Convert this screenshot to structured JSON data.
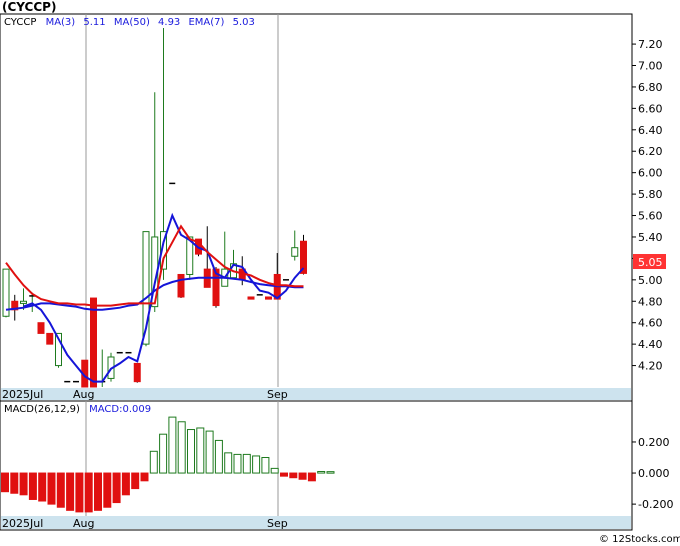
{
  "ticker": "(CYCCP)",
  "legend": {
    "symbol": "CYCCP",
    "ma3_label": "MA(3)",
    "ma3_value": "5.11",
    "ma50_label": "MA(50)",
    "ma50_value": "4.93",
    "ema7_label": "EMA(7)",
    "ema7_value": "5.03"
  },
  "last_price_label": "5.05",
  "macd_legend": {
    "params": "MACD(26,12,9)",
    "value": "MACD:0.009"
  },
  "month_labels_price": [
    "2025Jul",
    "Aug",
    "Sep"
  ],
  "month_labels_macd": [
    "2025Jul",
    "Aug",
    "Sep"
  ],
  "watermark": "© 12Stocks.com",
  "colors": {
    "up_candle": "#1e7a1e",
    "down_candle": "#e01010",
    "ma3": "#1515d8",
    "ma50": "#1515d8",
    "ema7": "#e01010",
    "axis_band": "#cde3ee",
    "last_price_box": "#ff3333",
    "macd_positive": "#1e7a1e",
    "macd_negative": "#e01010"
  },
  "chart_data": [
    {
      "type": "candlestick",
      "title": "(CYCCP)",
      "ylim": [
        4.0,
        7.35
      ],
      "yticks": [
        4.2,
        4.4,
        4.6,
        4.8,
        5.0,
        5.2,
        5.4,
        5.6,
        5.8,
        6.0,
        6.2,
        6.4,
        6.6,
        6.8,
        7.0,
        7.2
      ],
      "ytick_labels": [
        "4.20",
        "4.40",
        "4.60",
        "4.80",
        "5.00",
        "5.20",
        "5.40",
        "5.60",
        "5.80",
        "6.00",
        "6.20",
        "6.40",
        "6.60",
        "6.80",
        "7.00",
        "7.20"
      ],
      "candles": [
        {
          "o": 4.66,
          "h": 5.1,
          "l": 4.65,
          "c": 5.1
        },
        {
          "o": 4.8,
          "h": 4.86,
          "l": 4.62,
          "c": 4.72
        },
        {
          "o": 4.78,
          "h": 4.92,
          "l": 4.72,
          "c": 4.8
        },
        {
          "o": 4.85,
          "h": 4.88,
          "l": 4.7,
          "c": 4.85
        },
        {
          "o": 4.6,
          "h": 4.6,
          "l": 4.5,
          "c": 4.5
        },
        {
          "o": 4.5,
          "h": 4.5,
          "l": 4.4,
          "c": 4.4
        },
        {
          "o": 4.2,
          "h": 4.5,
          "l": 4.18,
          "c": 4.5
        },
        {
          "o": 4.05,
          "h": 4.05,
          "l": 4.05,
          "c": 4.05
        },
        {
          "o": 4.05,
          "h": 4.05,
          "l": 4.05,
          "c": 4.05
        },
        {
          "o": 4.25,
          "h": 4.25,
          "l": 4.0,
          "c": 4.0
        },
        {
          "o": 4.83,
          "h": 4.83,
          "l": 4.0,
          "c": 4.0
        },
        {
          "o": 4.04,
          "h": 4.35,
          "l": 4.0,
          "c": 4.05
        },
        {
          "o": 4.08,
          "h": 4.32,
          "l": 4.05,
          "c": 4.28
        },
        {
          "o": 4.32,
          "h": 4.32,
          "l": 4.32,
          "c": 4.32
        },
        {
          "o": 4.32,
          "h": 4.32,
          "l": 4.32,
          "c": 4.32
        },
        {
          "o": 4.22,
          "h": 4.22,
          "l": 4.04,
          "c": 4.05
        },
        {
          "o": 4.4,
          "h": 5.45,
          "l": 4.38,
          "c": 5.45
        },
        {
          "o": 4.75,
          "h": 6.75,
          "l": 4.7,
          "c": 5.4
        },
        {
          "o": 5.1,
          "h": 7.35,
          "l": 5.0,
          "c": 5.45
        },
        {
          "o": 5.9,
          "h": 5.9,
          "l": 5.9,
          "c": 5.9
        },
        {
          "o": 5.05,
          "h": 5.05,
          "l": 4.83,
          "c": 4.84
        },
        {
          "o": 5.05,
          "h": 5.4,
          "l": 5.0,
          "c": 5.4
        },
        {
          "o": 5.38,
          "h": 5.38,
          "l": 5.22,
          "c": 5.24
        },
        {
          "o": 5.1,
          "h": 5.5,
          "l": 4.93,
          "c": 4.93
        },
        {
          "o": 5.1,
          "h": 5.12,
          "l": 4.74,
          "c": 4.76
        },
        {
          "o": 4.94,
          "h": 5.45,
          "l": 4.94,
          "c": 5.1
        },
        {
          "o": 5.02,
          "h": 5.28,
          "l": 5.02,
          "c": 5.15
        },
        {
          "o": 5.1,
          "h": 5.22,
          "l": 4.95,
          "c": 5.0
        },
        {
          "o": 4.84,
          "h": 4.84,
          "l": 4.82,
          "c": 4.82
        },
        {
          "o": 4.86,
          "h": 4.86,
          "l": 4.86,
          "c": 4.86
        },
        {
          "o": 4.84,
          "h": 4.84,
          "l": 4.82,
          "c": 4.82
        },
        {
          "o": 5.05,
          "h": 5.25,
          "l": 4.82,
          "c": 4.82
        },
        {
          "o": 5.0,
          "h": 5.0,
          "l": 5.0,
          "c": 5.0
        },
        {
          "o": 5.22,
          "h": 5.46,
          "l": 5.18,
          "c": 5.3
        },
        {
          "o": 5.36,
          "h": 5.42,
          "l": 5.05,
          "c": 5.06
        }
      ],
      "series": [
        {
          "name": "MA(3)",
          "values": [
            null,
            null,
            4.75,
            4.78,
            4.72,
            4.6,
            4.45,
            4.3,
            4.2,
            4.1,
            4.05,
            4.05,
            4.17,
            4.22,
            4.28,
            4.24,
            4.55,
            4.97,
            5.35,
            5.6,
            5.42,
            5.37,
            5.3,
            5.27,
            5.06,
            5.02,
            5.14,
            5.12,
            5.0,
            4.9,
            4.88,
            4.83,
            4.9,
            5.02,
            5.11
          ]
        },
        {
          "name": "MA(50)",
          "values": [
            4.72,
            4.73,
            4.74,
            4.76,
            4.78,
            4.78,
            4.77,
            4.76,
            4.75,
            4.73,
            4.72,
            4.72,
            4.73,
            4.74,
            4.76,
            4.77,
            4.83,
            4.9,
            4.95,
            4.98,
            5.0,
            5.01,
            5.02,
            5.02,
            5.02,
            5.02,
            5.01,
            5.0,
            4.98,
            4.96,
            4.95,
            4.94,
            4.94,
            4.93,
            4.93
          ]
        },
        {
          "name": "EMA(7)",
          "values": [
            5.16,
            5.05,
            4.95,
            4.87,
            4.82,
            4.8,
            4.78,
            4.78,
            4.77,
            4.77,
            4.76,
            4.76,
            4.76,
            4.77,
            4.78,
            4.78,
            4.78,
            4.78,
            5.2,
            5.35,
            5.5,
            5.38,
            5.35,
            5.26,
            5.19,
            5.12,
            5.08,
            5.06,
            5.04,
            5.0,
            4.97,
            4.95,
            4.95,
            4.94,
            4.94
          ]
        }
      ]
    },
    {
      "type": "bar",
      "title": "MACD(26,12,9)",
      "ylim": [
        -0.27,
        0.38
      ],
      "yticks": [
        0.2,
        0.0,
        -0.2
      ],
      "ytick_labels": [
        "0.200",
        "0.000",
        "-0.200"
      ],
      "values": [
        -0.12,
        -0.13,
        -0.14,
        -0.17,
        -0.18,
        -0.2,
        -0.22,
        -0.24,
        -0.25,
        -0.25,
        -0.24,
        -0.22,
        -0.19,
        -0.14,
        -0.1,
        -0.05,
        0.14,
        0.25,
        0.36,
        0.33,
        0.28,
        0.29,
        0.27,
        0.21,
        0.13,
        0.12,
        0.12,
        0.11,
        0.1,
        0.03,
        -0.02,
        -0.03,
        -0.04,
        -0.05,
        0.01,
        0.009
      ]
    }
  ]
}
